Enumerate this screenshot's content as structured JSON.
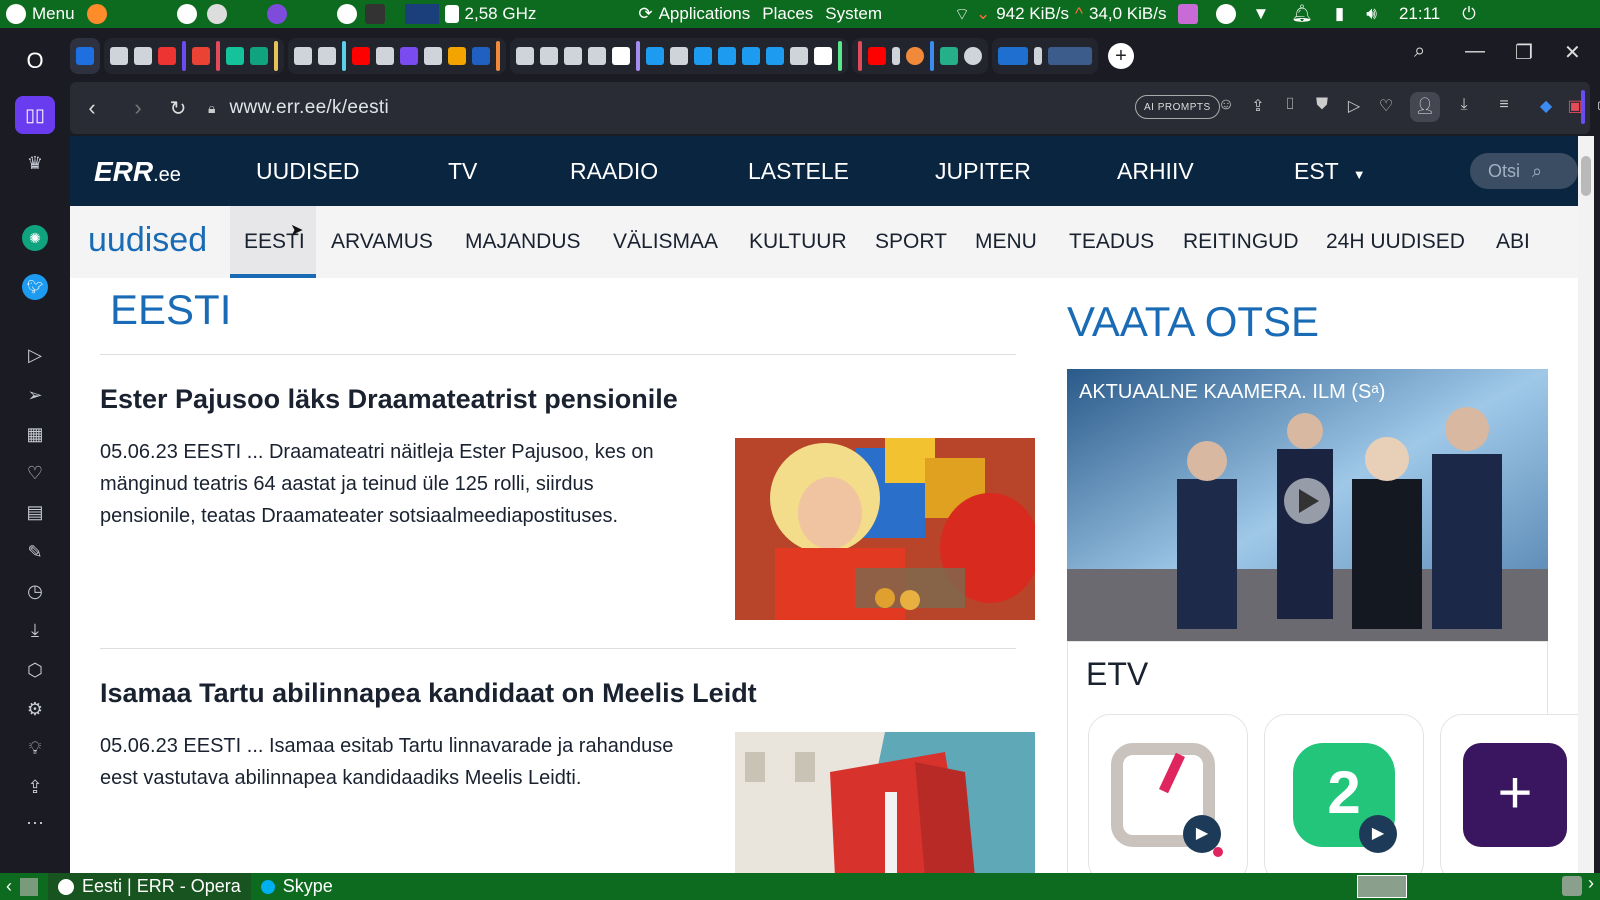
{
  "system_panel": {
    "menu_label": "Menu",
    "cpu_freq": "2,58 GHz",
    "applications_label": "Applications",
    "places_label": "Places",
    "system_label": "System",
    "net_down": "942 KiB/s",
    "net_up": "34,0 KiB/s",
    "clock": "21:11"
  },
  "browser": {
    "url": "www.err.ee/k/eesti",
    "ai_prompts_label": "AI PROMPTS"
  },
  "err": {
    "logo": "ERR",
    "logo_suffix": ".ee",
    "top_nav": [
      "UUDISED",
      "TV",
      "RAADIO",
      "LASTELE",
      "JUPITER",
      "ARHIIV"
    ],
    "lang": "EST",
    "search_placeholder": "Otsi",
    "subnav_brand": "uudised",
    "subnav": [
      "EESTI",
      "ARVAMUS",
      "MAJANDUS",
      "VÄLISMAA",
      "KULTUUR",
      "SPORT",
      "MENU",
      "TEADUS",
      "REITINGUD",
      "24H UUDISED",
      "ABI"
    ],
    "section_title": "EESTI",
    "articles": [
      {
        "title": "Ester Pajusoo läks Draamateatrist pensionile",
        "body": "05.06.23 EESTI ... Draamateatri näitleja Ester Pajusoo, kes on mänginud teatris 64 aastat ja teinud üle 125 rolli, siirdus pensionile, teatas Draamateater sotsiaalmeediapostituses."
      },
      {
        "title": "Isamaa Tartu abilinnapea kandidaat on Meelis Leidt",
        "body": "05.06.23 EESTI ... Isamaa esitab Tartu linnavarade ja rahanduse eest vastutava abilinnapea kandidaadiks Meelis Leidti."
      }
    ],
    "live_title": "VAATA OTSE",
    "live_caption": "AKTUAALNE KAAMERA. ILM (Sᵃ)",
    "etv_label": "ETV"
  },
  "taskbar": {
    "task1": "Eesti | ERR - Opera",
    "task2": "Skype"
  }
}
